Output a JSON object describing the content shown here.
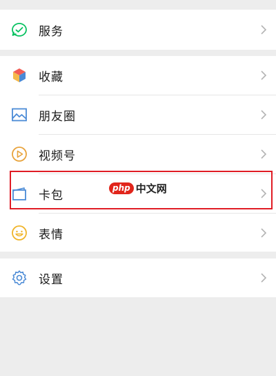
{
  "menu": {
    "services": {
      "label": "服务",
      "icon": "services-icon"
    },
    "favorites": {
      "label": "收藏",
      "icon": "favorites-cube-icon"
    },
    "moments": {
      "label": "朋友圈",
      "icon": "moments-image-icon"
    },
    "channels": {
      "label": "视频号",
      "icon": "channels-play-icon"
    },
    "card_wallet": {
      "label": "卡包",
      "icon": "card-wallet-icon"
    },
    "stickers": {
      "label": "表情",
      "icon": "smiley-icon"
    },
    "settings": {
      "label": "设置",
      "icon": "gear-icon"
    }
  },
  "watermark": {
    "brand": "php",
    "text": "中文网"
  },
  "colors": {
    "background": "#ededed",
    "card": "#ffffff",
    "highlight_border": "#e01b24",
    "icon_green": "#07c160",
    "icon_blue": "#4a8ad6",
    "icon_orange": "#f5a623",
    "icon_gold": "#e8a33c"
  }
}
